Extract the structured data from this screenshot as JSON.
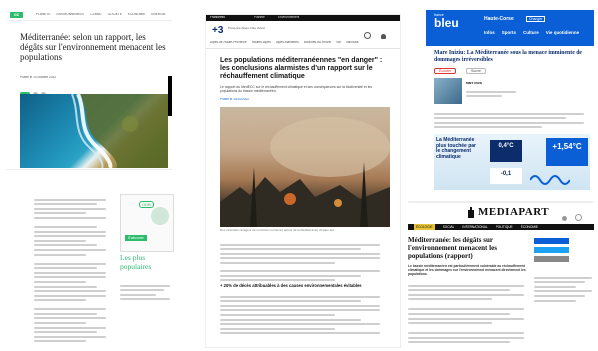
{
  "colors": {
    "accent_green": "#2dbb6c",
    "bleu_blue": "#0a5fd6",
    "bleu_dark": "#0c2c6b",
    "mediapart_black": "#111111",
    "coast_blue": "#1f8fb8",
    "smoke": "#c5a88a"
  },
  "shot1": {
    "logo": "oz",
    "nav": [
      "PLANÈTE",
      "ENVIRONNEMENT",
      "CLIMAT",
      "SOCIÉTÉ",
      "ÉCONOMIE",
      "ÉNERGIE"
    ],
    "title": "Méditerranée: selon un rapport, les dégâts sur l'environnement menacent les populations",
    "meta": "Publié le 10 octobre 2022",
    "image": "coastline-photo"
  },
  "shot2": {
    "brand_line": "Franceinfo",
    "nav_tabs": [
      "Planète",
      "Environnement"
    ],
    "logo": "+3",
    "logo_sub": "Provence Alpes Côte d'Azur",
    "nav": [
      "Alpes-de-Haute-Provence",
      "Hautes-Alpes",
      "Alpes-Maritimes",
      "Bouches-du-Rhône",
      "Var",
      "Vaucluse"
    ],
    "title": "Les populations méditerranéennes \"en danger\" : les conclusions alarmistes d'un rapport sur le réchauffement climatique",
    "lede": "Le rapport du MedECC sur le réchauffement climatique et ses conséquences sur la biodiversité et les populations du bassin méditerranéen.",
    "byline": "Publié le 10/10/2022",
    "caption": "Des incendies ravagent de nombreux territoires autour de la Méditerranée chaque été.",
    "h2": "+ 20% de décès attribuables à des causes environnementales évitables"
  },
  "shot3": {
    "logo_top": "france",
    "logo_main": "bleu",
    "station": "Haute-Corse",
    "change_label": "Changer",
    "nav": [
      "Infos",
      "Sports",
      "Culture",
      "Vie quotidienne"
    ],
    "title": "Mare Iniziu: La Méditerranée sous la menace imminente de dommages irréversibles",
    "btn_listen": "Écouter",
    "btn_follow": "Suivre",
    "author": "Mare Iniziu",
    "infographic_title": "La Méditerranée plus touchée par le changement climatique",
    "stat1": "0,4°C",
    "stat2": "+1,54°C",
    "stat3": "-0,1"
  },
  "shot4": {
    "badge": "ODB",
    "title": "Les plus populaires",
    "cta": "S'abonner"
  },
  "shot5": {
    "logo": "MEDIAPART",
    "tabs": [
      "ÉCOLOGIE",
      "SOCIAL",
      "INTERNATIONAL",
      "POLITIQUE",
      "ÉCONOMIE"
    ],
    "title": "Méditerranée: les dégâts sur l'environnement menacent les populations (rapport)",
    "lede": "Le bassin méditerranéen est particulièrement vulnérable au réchauffement climatique et les dommages sur l'environnement menacent directement les populations."
  }
}
